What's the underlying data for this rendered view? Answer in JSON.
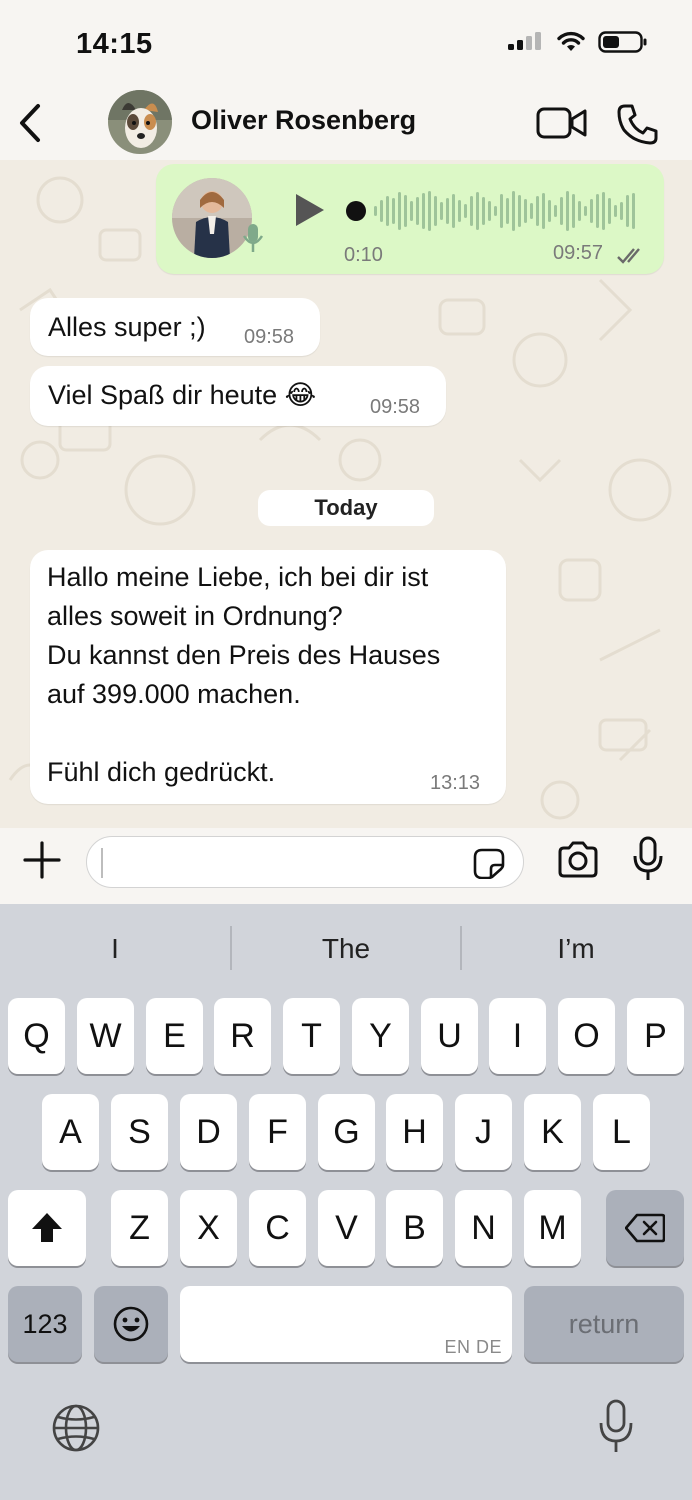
{
  "status_bar": {
    "time": "14:15"
  },
  "header": {
    "contact_name": "Oliver Rosenberg"
  },
  "messages": [
    {
      "type": "voice",
      "duration": "0:10",
      "time": "09:57"
    },
    {
      "type": "text",
      "text": "Alles super ;)",
      "time": "09:58"
    },
    {
      "type": "text",
      "text": "Viel Spaß dir heute 😂",
      "time": "09:58"
    },
    {
      "type": "text",
      "text": "Hallo meine Liebe, ich bei dir ist\nalles soweit in Ordnung?\nDu kannst den Preis des Hauses\nauf 399.000 machen.\n\nFühl dich gedrückt.",
      "time": "13:13"
    }
  ],
  "date_separator": "Today",
  "input": {
    "value": "",
    "placeholder": ""
  },
  "keyboard": {
    "suggestions": [
      "I",
      "The",
      "I’m"
    ],
    "row1": [
      "Q",
      "W",
      "E",
      "R",
      "T",
      "Y",
      "U",
      "I",
      "O",
      "P"
    ],
    "row2": [
      "A",
      "S",
      "D",
      "F",
      "G",
      "H",
      "J",
      "K",
      "L"
    ],
    "row3": [
      "Z",
      "X",
      "C",
      "V",
      "B",
      "N",
      "M"
    ],
    "numbers_key": "123",
    "return_key": "return",
    "space_lang": "EN DE"
  },
  "colors": {
    "outgoing_bubble": "#dcf8c6",
    "incoming_bubble": "#ffffff",
    "chat_background": "#f1ece3",
    "keyboard_background": "#d1d4da"
  }
}
